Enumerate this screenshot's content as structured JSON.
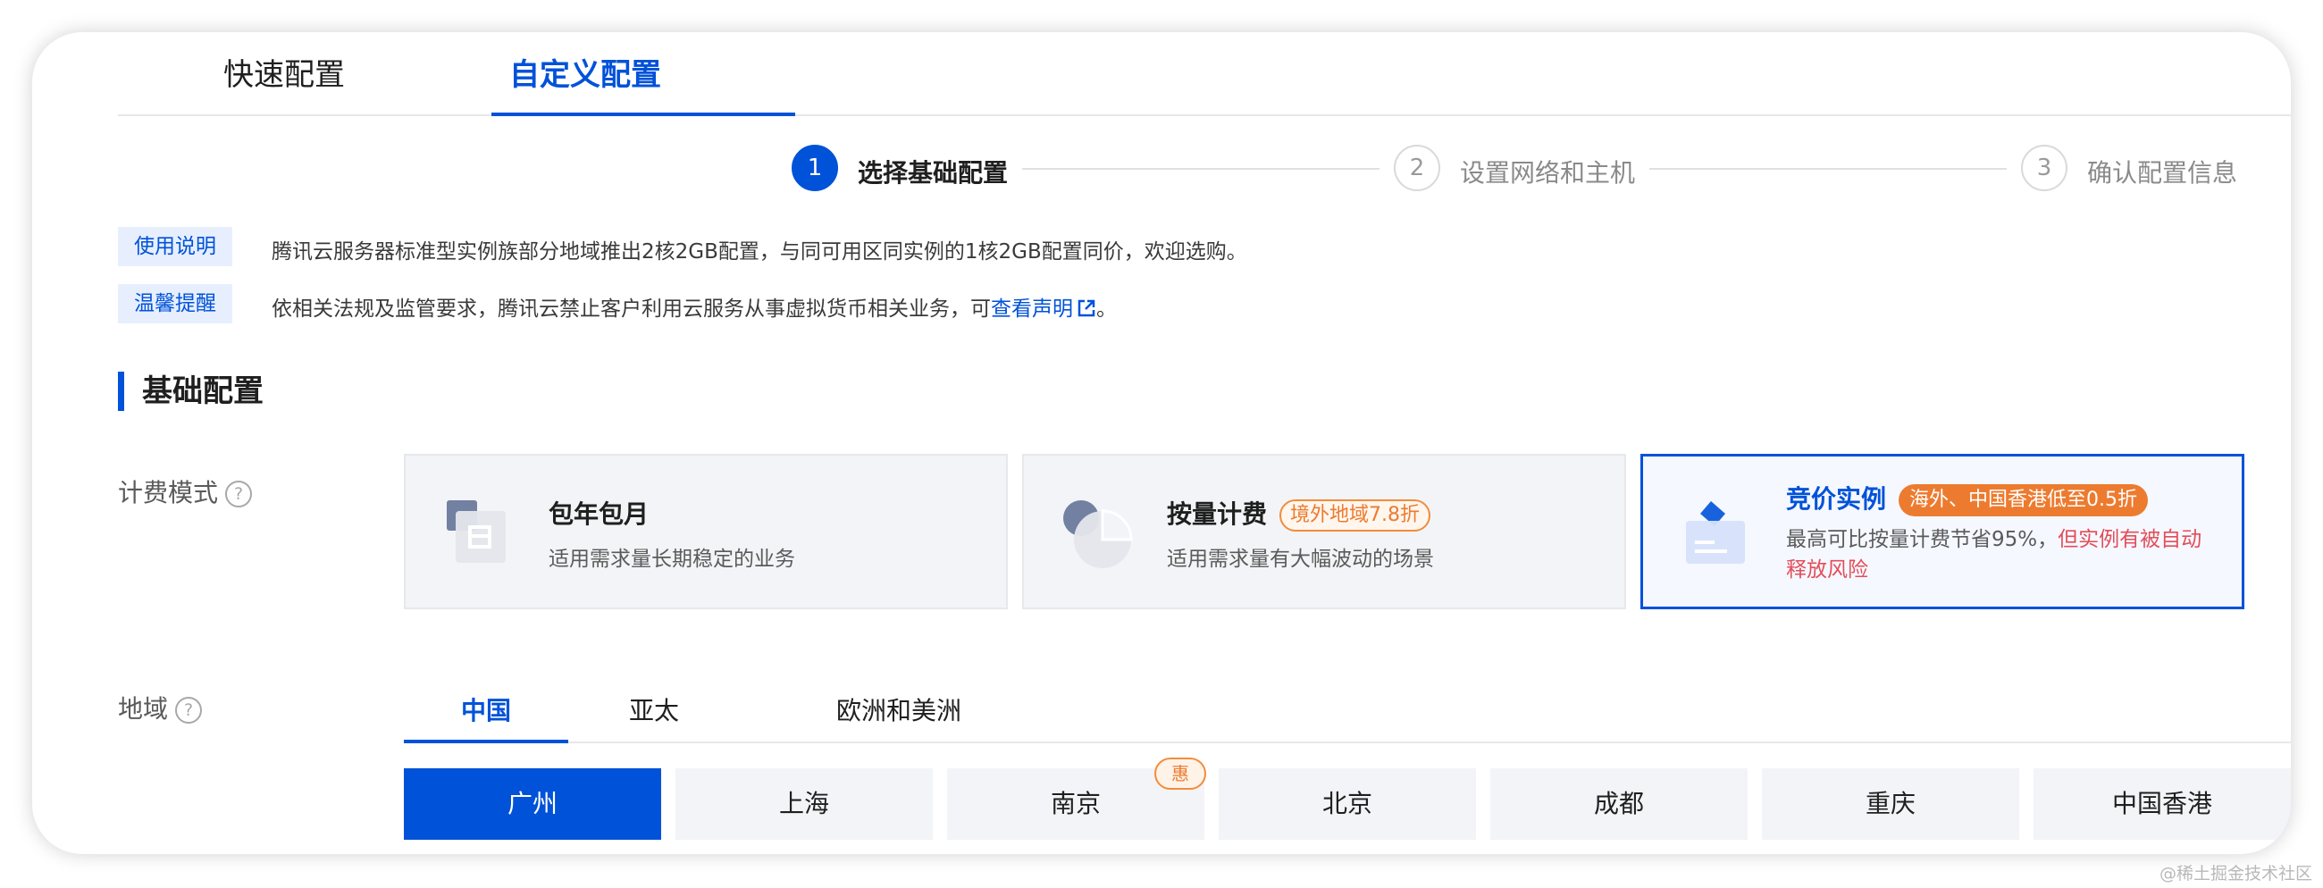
{
  "page_tabs": [
    {
      "label": "快速配置",
      "active": false
    },
    {
      "label": "自定义配置",
      "active": true
    }
  ],
  "steps": [
    {
      "number": "1",
      "label": "选择基础配置",
      "active": true
    },
    {
      "number": "2",
      "label": "设置网络和主机",
      "active": false
    },
    {
      "number": "3",
      "label": "确认配置信息",
      "active": false
    }
  ],
  "notices": [
    {
      "tag": "使用说明",
      "text": "腾讯云服务器标准型实例族部分地域推出2核2GB配置，与同可用区同实例的1核2GB配置同价，欢迎选购。"
    },
    {
      "tag": "温馨提醒",
      "text": "依相关法规及监管要求，腾讯云禁止客户利用云服务从事虚拟货币相关业务，可",
      "link": "查看声明",
      "suffix": "。"
    }
  ],
  "section_title": "基础配置",
  "billing": {
    "label": "计费模式",
    "help": "?",
    "cards": [
      {
        "title": "包年包月",
        "desc": "适用需求量长期稳定的业务",
        "selected": false
      },
      {
        "title": "按量计费",
        "badge": "境外地域7.8折",
        "desc": "适用需求量有大幅波动的场景",
        "selected": false
      },
      {
        "title": "竞价实例",
        "badge": "海外、中国香港低至0.5折",
        "desc": "最高可比按量计费节省95%，",
        "desc_warn": "但实例有被自动释放风险",
        "selected": true
      }
    ]
  },
  "region": {
    "label": "地域",
    "help": "?",
    "tabs": [
      {
        "label": "中国",
        "active": true
      },
      {
        "label": "亚太",
        "active": false
      },
      {
        "label": "欧洲和美洲",
        "active": false
      }
    ],
    "cities": [
      {
        "label": "广州",
        "active": true
      },
      {
        "label": "上海",
        "active": false
      },
      {
        "label": "南京",
        "active": false,
        "badge": "惠"
      },
      {
        "label": "北京",
        "active": false
      },
      {
        "label": "成都",
        "active": false
      },
      {
        "label": "重庆",
        "active": false
      },
      {
        "label": "中国香港",
        "active": false
      }
    ]
  },
  "watermark": "@稀土掘金技术社区",
  "colors": {
    "primary": "#0052d9",
    "warning": "#ed7b2f",
    "danger": "#e34d59"
  }
}
